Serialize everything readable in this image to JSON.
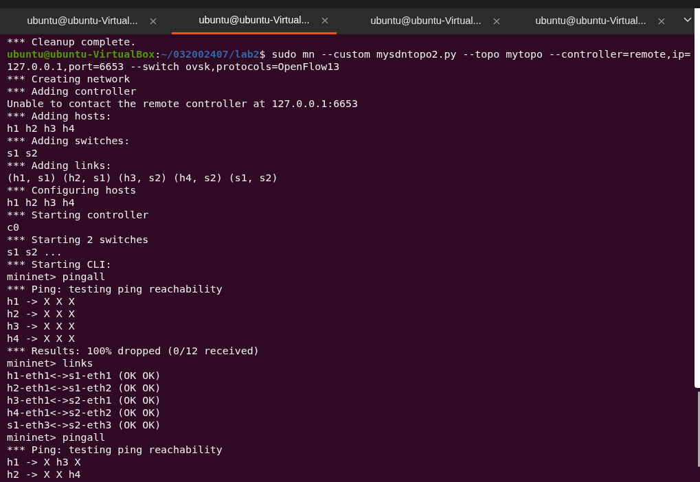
{
  "tabs": [
    {
      "label": "ubuntu@ubuntu-Virtual...",
      "selected": false
    },
    {
      "label": "ubuntu@ubuntu-Virtual...",
      "selected": true
    },
    {
      "label": "ubuntu@ubuntu-Virtual...",
      "selected": false
    },
    {
      "label": "ubuntu@ubuntu-Virtual...",
      "selected": false
    }
  ],
  "terminal": {
    "lines": [
      {
        "kind": "text",
        "text": "*** Cleanup complete."
      },
      {
        "kind": "prompt",
        "user": "ubuntu@ubuntu-VirtualBox",
        "separator": ":",
        "path": "~/032002407/lab2",
        "command": "$ sudo mn --custom mysdntopo2.py --topo mytopo --controller=remote,ip="
      },
      {
        "kind": "text",
        "text": "127.0.0.1,port=6653 --switch ovsk,protocols=OpenFlow13"
      },
      {
        "kind": "text",
        "text": "*** Creating network"
      },
      {
        "kind": "text",
        "text": "*** Adding controller"
      },
      {
        "kind": "text",
        "text": "Unable to contact the remote controller at 127.0.0.1:6653"
      },
      {
        "kind": "text",
        "text": "*** Adding hosts:"
      },
      {
        "kind": "text",
        "text": "h1 h2 h3 h4"
      },
      {
        "kind": "text",
        "text": "*** Adding switches:"
      },
      {
        "kind": "text",
        "text": "s1 s2"
      },
      {
        "kind": "text",
        "text": "*** Adding links:"
      },
      {
        "kind": "text",
        "text": "(h1, s1) (h2, s1) (h3, s2) (h4, s2) (s1, s2)"
      },
      {
        "kind": "text",
        "text": "*** Configuring hosts"
      },
      {
        "kind": "text",
        "text": "h1 h2 h3 h4"
      },
      {
        "kind": "text",
        "text": "*** Starting controller"
      },
      {
        "kind": "text",
        "text": "c0"
      },
      {
        "kind": "text",
        "text": "*** Starting 2 switches"
      },
      {
        "kind": "text",
        "text": "s1 s2 ..."
      },
      {
        "kind": "text",
        "text": "*** Starting CLI:"
      },
      {
        "kind": "text",
        "text": "mininet> pingall"
      },
      {
        "kind": "text",
        "text": "*** Ping: testing ping reachability"
      },
      {
        "kind": "text",
        "text": "h1 -> X X X"
      },
      {
        "kind": "text",
        "text": "h2 -> X X X"
      },
      {
        "kind": "text",
        "text": "h3 -> X X X"
      },
      {
        "kind": "text",
        "text": "h4 -> X X X"
      },
      {
        "kind": "text",
        "text": "*** Results: 100% dropped (0/12 received)"
      },
      {
        "kind": "text",
        "text": "mininet> links"
      },
      {
        "kind": "text",
        "text": "h1-eth1<->s1-eth1 (OK OK)"
      },
      {
        "kind": "text",
        "text": "h2-eth1<->s1-eth2 (OK OK)"
      },
      {
        "kind": "text",
        "text": "h3-eth1<->s2-eth1 (OK OK)"
      },
      {
        "kind": "text",
        "text": "h4-eth1<->s2-eth2 (OK OK)"
      },
      {
        "kind": "text",
        "text": "s1-eth3<->s2-eth3 (OK OK)"
      },
      {
        "kind": "text",
        "text": "mininet> pingall"
      },
      {
        "kind": "text",
        "text": "*** Ping: testing ping reachability"
      },
      {
        "kind": "text",
        "text": "h1 -> X h3 X"
      },
      {
        "kind": "text",
        "text": "h2 -> X X h4"
      }
    ]
  }
}
